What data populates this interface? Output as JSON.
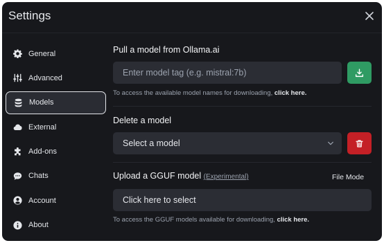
{
  "window": {
    "title": "Settings",
    "close_icon": "close-icon"
  },
  "sidebar": {
    "items": [
      {
        "label": "General",
        "icon": "gear-icon",
        "active": false
      },
      {
        "label": "Advanced",
        "icon": "sliders-icon",
        "active": false
      },
      {
        "label": "Models",
        "icon": "database-icon",
        "active": true
      },
      {
        "label": "External",
        "icon": "cloud-icon",
        "active": false
      },
      {
        "label": "Add-ons",
        "icon": "puzzle-icon",
        "active": false
      },
      {
        "label": "Chats",
        "icon": "chat-bubble-icon",
        "active": false
      },
      {
        "label": "Account",
        "icon": "user-circle-icon",
        "active": false
      },
      {
        "label": "About",
        "icon": "info-icon",
        "active": false
      }
    ]
  },
  "pull": {
    "title": "Pull a model from Ollama.ai",
    "placeholder": "Enter model tag (e.g. mistral:7b)",
    "hint_text": "To access the available model names for downloading,",
    "hint_link": "click here.",
    "button_color": "#2f9b63"
  },
  "delete": {
    "title": "Delete a model",
    "select_value": "Select a model",
    "button_color": "#c42026"
  },
  "upload": {
    "title": "Upload a GGUF model",
    "experimental": "(Experimental)",
    "file_mode": "File Mode",
    "button_label": "Click here to select",
    "hint_text": "To access the GGUF models available for downloading,",
    "hint_link": "click here."
  }
}
